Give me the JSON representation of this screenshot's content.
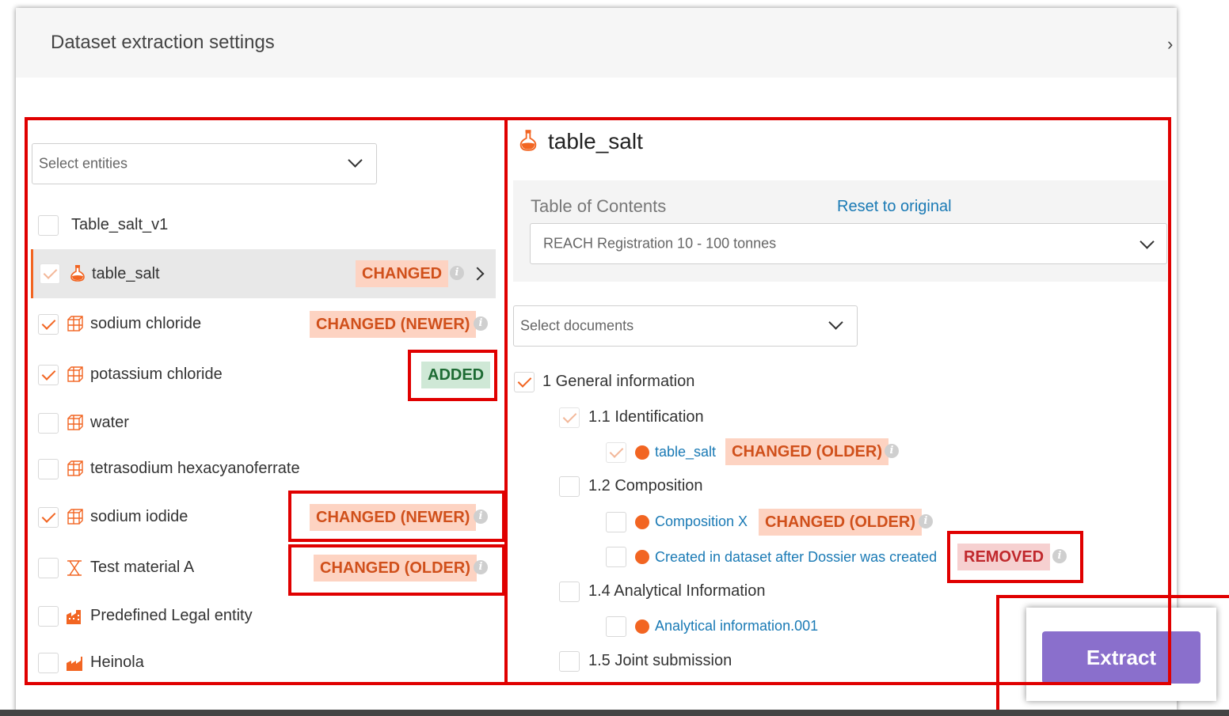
{
  "dialog": {
    "title": "Dataset extraction settings",
    "close_icon": "›"
  },
  "left": {
    "select_placeholder": "Select entities",
    "entities": [
      {
        "label": "Table_salt_v1"
      },
      {
        "label": "table_salt",
        "tag": "CHANGED"
      },
      {
        "label": "sodium chloride",
        "tag": "CHANGED (NEWER)"
      },
      {
        "label": "potassium chloride",
        "tag": "ADDED"
      },
      {
        "label": "water"
      },
      {
        "label": "tetrasodium hexacyanoferrate"
      },
      {
        "label": "sodium iodide",
        "tag": "CHANGED (NEWER)"
      },
      {
        "label": "Test material A",
        "tag": "CHANGED (OLDER)"
      },
      {
        "label": "Predefined Legal entity"
      },
      {
        "label": "Heinola"
      }
    ]
  },
  "right": {
    "entity_title": "table_salt",
    "toc_label": "Table of Contents",
    "reset_link": "Reset to original",
    "toc_value": "REACH Registration 10 - 100 tonnes",
    "documents_placeholder": "Select documents",
    "tree": {
      "general": "1 General information",
      "identification": "1.1 Identification",
      "doc_table_salt": "table_salt",
      "doc_table_salt_tag": "CHANGED (OLDER)",
      "composition": "1.2 Composition",
      "doc_composition_x": "Composition X",
      "doc_composition_x_tag": "CHANGED (OLDER)",
      "doc_created": "Created in dataset after Dossier was created",
      "doc_created_tag": "REMOVED",
      "analytical": "1.4 Analytical Information",
      "doc_analytical": "Analytical information.001",
      "joint": "1.5 Joint submission"
    }
  },
  "extract_label": "Extract",
  "colors": {
    "accent": "#f26522",
    "link": "#1a7ab5",
    "extract": "#8a6fcc",
    "highlight_border": "#e00000"
  }
}
